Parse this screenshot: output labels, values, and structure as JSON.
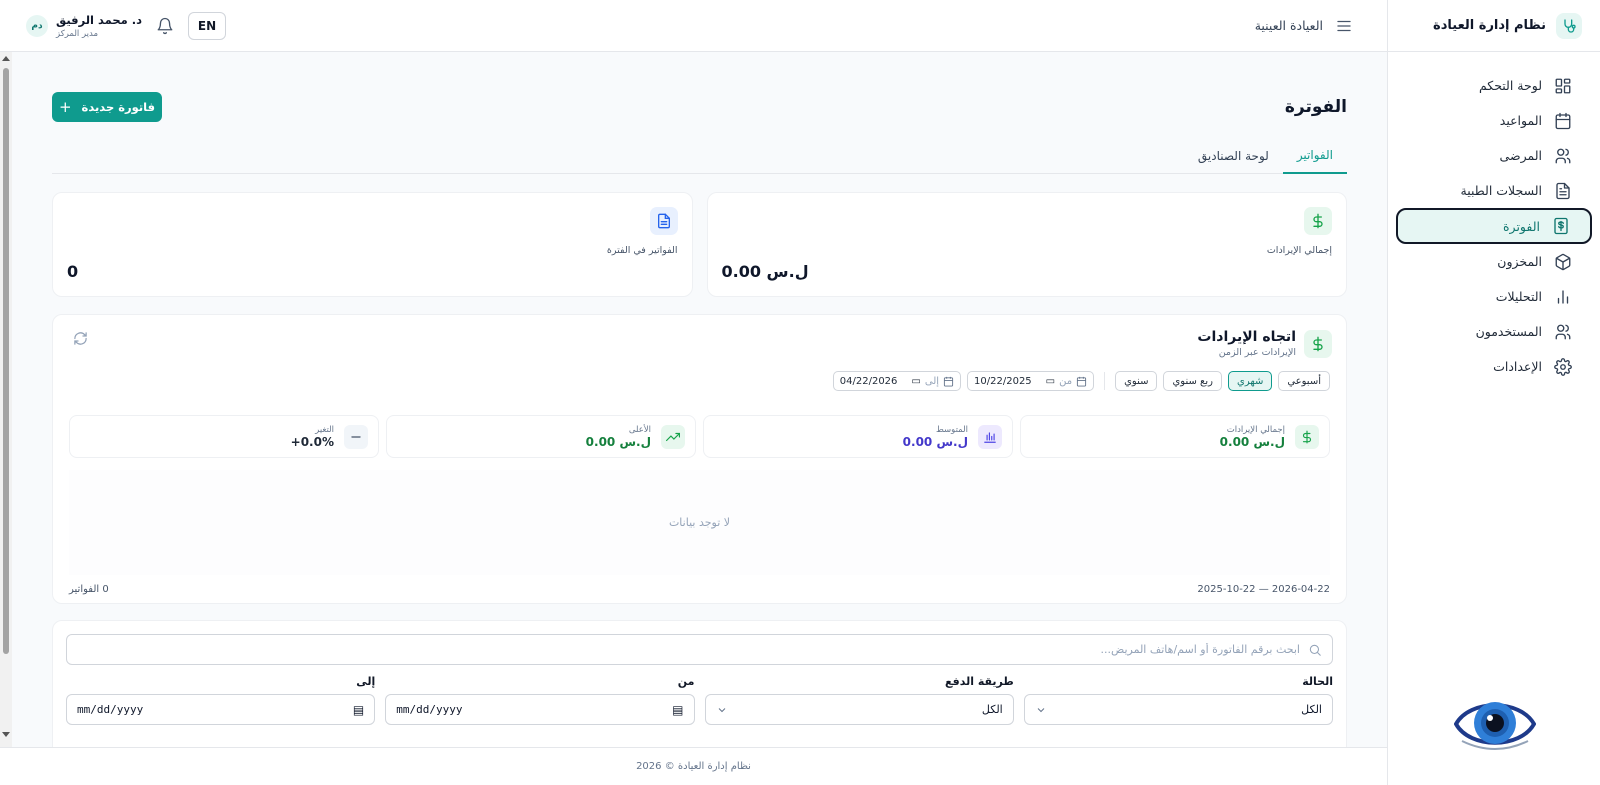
{
  "sidebar": {
    "brand": "نظام إدارة العيادة",
    "items": [
      {
        "label": "لوحة التحكم",
        "icon": "dashboard-icon"
      },
      {
        "label": "المواعيد",
        "icon": "calendar-icon"
      },
      {
        "label": "المرضى",
        "icon": "users-icon"
      },
      {
        "label": "السجلات الطبية",
        "icon": "document-icon"
      },
      {
        "label": "الفوترة",
        "icon": "billing-icon",
        "active": true
      },
      {
        "label": "المخزون",
        "icon": "box-icon"
      },
      {
        "label": "التحليلات",
        "icon": "bar-chart-icon"
      },
      {
        "label": "المستخدمون",
        "icon": "users-icon"
      },
      {
        "label": "الإعدادات",
        "icon": "gear-icon"
      }
    ]
  },
  "header": {
    "clinic": "العيادة العينية",
    "lang": "EN",
    "user_initials": "دم",
    "user_name": "د. محمد الرفيق",
    "user_role": "مدير المركز"
  },
  "page": {
    "title": "الفوترة",
    "new_invoice": "فاتورة جديدة",
    "tabs": [
      "الفواتير",
      "لوحة الصناديق"
    ]
  },
  "stats": {
    "revenue_label": "إجمالي الإيرادات",
    "revenue_value": "0.00 ل.س",
    "invoices_label": "الفواتير في الفترة",
    "invoices_value": "0"
  },
  "trend": {
    "title": "اتجاه الإيرادات",
    "subtitle": "الإيرادات عبر الزمن",
    "periods": [
      "أسبوعي",
      "شهري",
      "ربع سنوي",
      "سنوي"
    ],
    "active_period": "شهري",
    "from_label": "من",
    "from_date": "10/22/2025",
    "to_label": "إلى",
    "to_date": "04/22/2026",
    "mini": [
      {
        "label": "إجمالي الإيرادات",
        "value": "0.00 ل.س"
      },
      {
        "label": "المتوسط",
        "value": "0.00 ل.س"
      },
      {
        "label": "الأعلى",
        "value": "0.00 ل.س"
      },
      {
        "label": "التغير",
        "value": "+0.0%"
      }
    ],
    "empty": "لا توجد بيانات",
    "range": "2025-10-22 — 2026-04-22",
    "count": "0 الفواتير"
  },
  "search": {
    "placeholder": "ابحث برقم الفاتورة أو اسم/هاتف المريض...",
    "status_label": "الحالة",
    "status_value": "الكل",
    "payment_label": "طريقة الدفع",
    "payment_value": "الكل",
    "from_label": "من",
    "from_value": "mm/dd/yyyy",
    "to_label": "إلى",
    "to_value": "mm/dd/yyyy"
  },
  "footer": "نظام إدارة العيادة © 2026",
  "colors": {
    "accent": "#0f9b8e",
    "sidebar_active_bg": "#e6f6f3"
  }
}
